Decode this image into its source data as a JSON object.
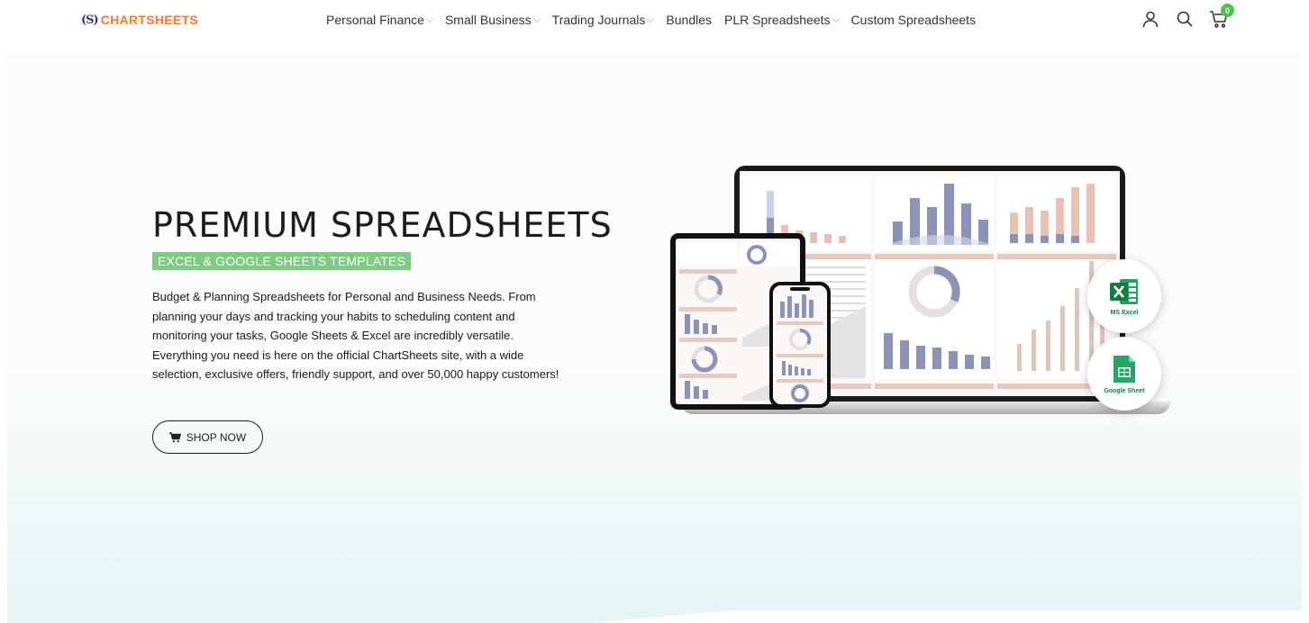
{
  "header": {
    "logo_mark": "S",
    "logo_text": "CHARTSHEETS",
    "nav": [
      {
        "label": "Personal Finance",
        "has_dropdown": true
      },
      {
        "label": "Small Business",
        "has_dropdown": true
      },
      {
        "label": "Trading Journals",
        "has_dropdown": true
      },
      {
        "label": "Bundles",
        "has_dropdown": false
      },
      {
        "label": "PLR Spreadsheets",
        "has_dropdown": true
      },
      {
        "label": "Custom Spreadsheets",
        "has_dropdown": false
      }
    ],
    "icons": [
      "account-icon",
      "search-icon",
      "cart-icon"
    ],
    "cart_count": "0"
  },
  "hero": {
    "title": "PREMIUM SPREADSHEETS",
    "badge": "EXCEL & GOOGLE SHEETS TEMPLATES",
    "description": "Budget & Planning Spreadsheets for Personal and Business Needs. From planning your days and tracking your habits to scheduling content and monitoring your tasks, Google Sheets & Excel are incredibly versatile. Everything you need is here on the official ChartSheets site, with a wide selection, exclusive offers, friendly support, and over 50,000 happy customers!",
    "cta_label": "SHOP NOW",
    "apps": [
      {
        "label": "MS Excel",
        "icon": "excel-icon"
      },
      {
        "label": "Google Sheet",
        "icon": "google-sheets-icon"
      }
    ]
  },
  "colors": {
    "brand_orange": "#f47c2c",
    "badge_green": "#7dcb81",
    "cart_badge": "#4cbf4c",
    "chart_blue": "#8c93b8",
    "chart_pink": "#e8c0b4"
  }
}
